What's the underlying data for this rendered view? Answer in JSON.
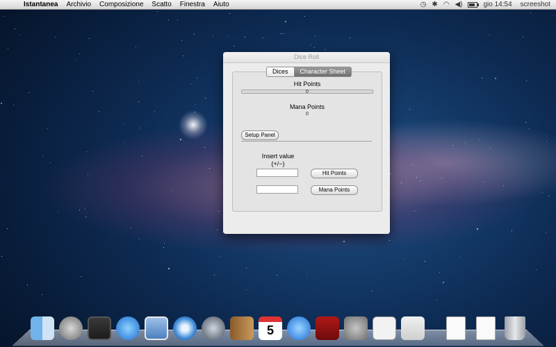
{
  "menubar": {
    "apple_glyph": "",
    "app_menu": "Istantanea",
    "menus": [
      "Archivio",
      "Composizione",
      "Scatto",
      "Finestra",
      "Aiuto"
    ],
    "clock": "gio 14:54",
    "user": "screeshot"
  },
  "window": {
    "title": "Dice Roll",
    "tabs": [
      "Dices",
      "Character Sheet"
    ],
    "selected_tab": "Character Sheet",
    "hit_points_label": "Hit Points",
    "hit_points_value": "0",
    "hit_points_fill": 0,
    "mana_points_label": "Mana Points",
    "mana_points_value": "0",
    "setup_panel_button": "Setup Panel",
    "insert_value_label": "Insert value",
    "insert_value_hint": "(+/−)",
    "hit_points_input_value": "",
    "mana_points_input_value": "",
    "hit_points_button": "Hit Points",
    "mana_points_button": "Mana Points"
  },
  "dock": {
    "items": [
      "finder-icon",
      "launchpad-icon",
      "mission-control-icon",
      "app-store-icon",
      "mail-icon",
      "safari-icon",
      "facetime-icon",
      "address-book-icon",
      "calendar-icon",
      "itunes-icon",
      "photo-booth-icon",
      "system-preferences-icon",
      "dice-roll-app-icon",
      "preview-icon",
      "document-icon",
      "document-icon",
      "trash-icon"
    ],
    "calendar_day": "5"
  },
  "colors": {
    "selected_tab": "#7d7d7d",
    "window_bg": "#ececec"
  }
}
